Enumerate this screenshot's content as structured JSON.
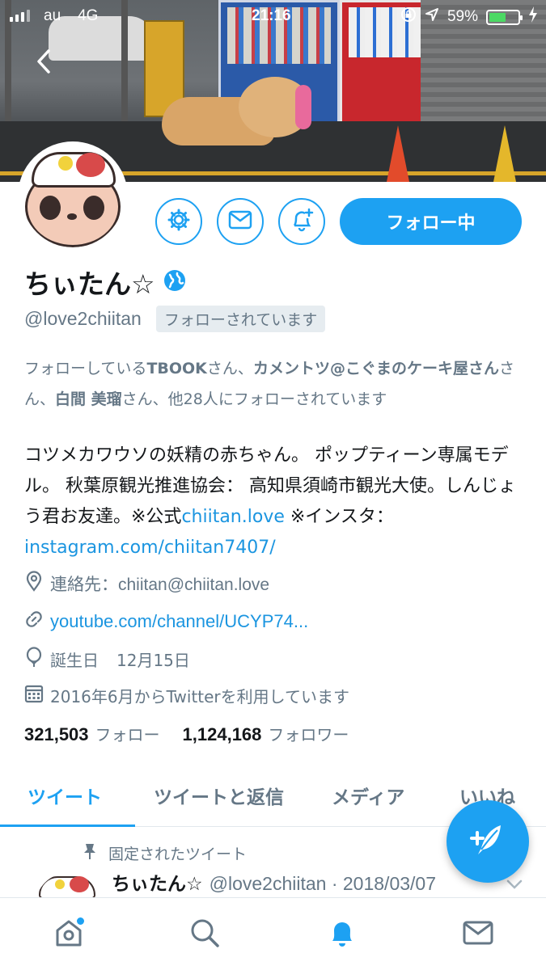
{
  "status_bar": {
    "carrier": "au",
    "network": "4G",
    "time": "21:16",
    "battery_percent": "59%",
    "battery_level": 0.59
  },
  "profile": {
    "name": "ちぃたん☆",
    "handle": "@love2chiitan",
    "follows_you_label": "フォローされています",
    "follow_button_label": "フォロー中",
    "followers_you_know": {
      "prefix": "フォローしている",
      "user1": "TBOOK",
      "sep1": "さん、",
      "user2": "カメントツ@こぐまのケーキ屋さん",
      "sep2": "さん、",
      "user3": "白間 美瑠",
      "suffix": "さん、他28人にフォローされています"
    },
    "bio": {
      "text1": "コツメカワウソの妖精の赤ちゃん。 ポップティーン専属モデル。 秋葉原観光推進協会： 高知県須崎市観光大使。しんじょう君お友達。※公式",
      "link1": "chiitan.love",
      "text2": " ※インスタ：",
      "link2": "instagram.com/chiitan7407/"
    },
    "location": "連絡先：chiitan@chiitan.love",
    "website": "youtube.com/channel/UCYP74...",
    "birthday_label": "誕生日",
    "birthday": "12月15日",
    "joined": "2016年6月からTwitterを利用しています",
    "following_count": "321,503",
    "following_label": "フォロー",
    "followers_count": "1,124,168",
    "followers_label": "フォロワー"
  },
  "tabs": [
    "ツイート",
    "ツイートと返信",
    "メディア",
    "いいね"
  ],
  "pinned_tweet": {
    "pinned_label": "固定されたツイート",
    "name": "ちぃたん☆",
    "handle_date": "@love2chiitan · 2018/03/07"
  },
  "icons": {
    "settings": "gear-icon",
    "message": "envelope-icon",
    "notifications": "bell-plus-icon",
    "verified": "globe-badge-icon",
    "compose": "quill-plus-icon"
  },
  "colors": {
    "accent": "#1da1f2",
    "link": "#1b95e0",
    "secondary_text": "#657786"
  }
}
